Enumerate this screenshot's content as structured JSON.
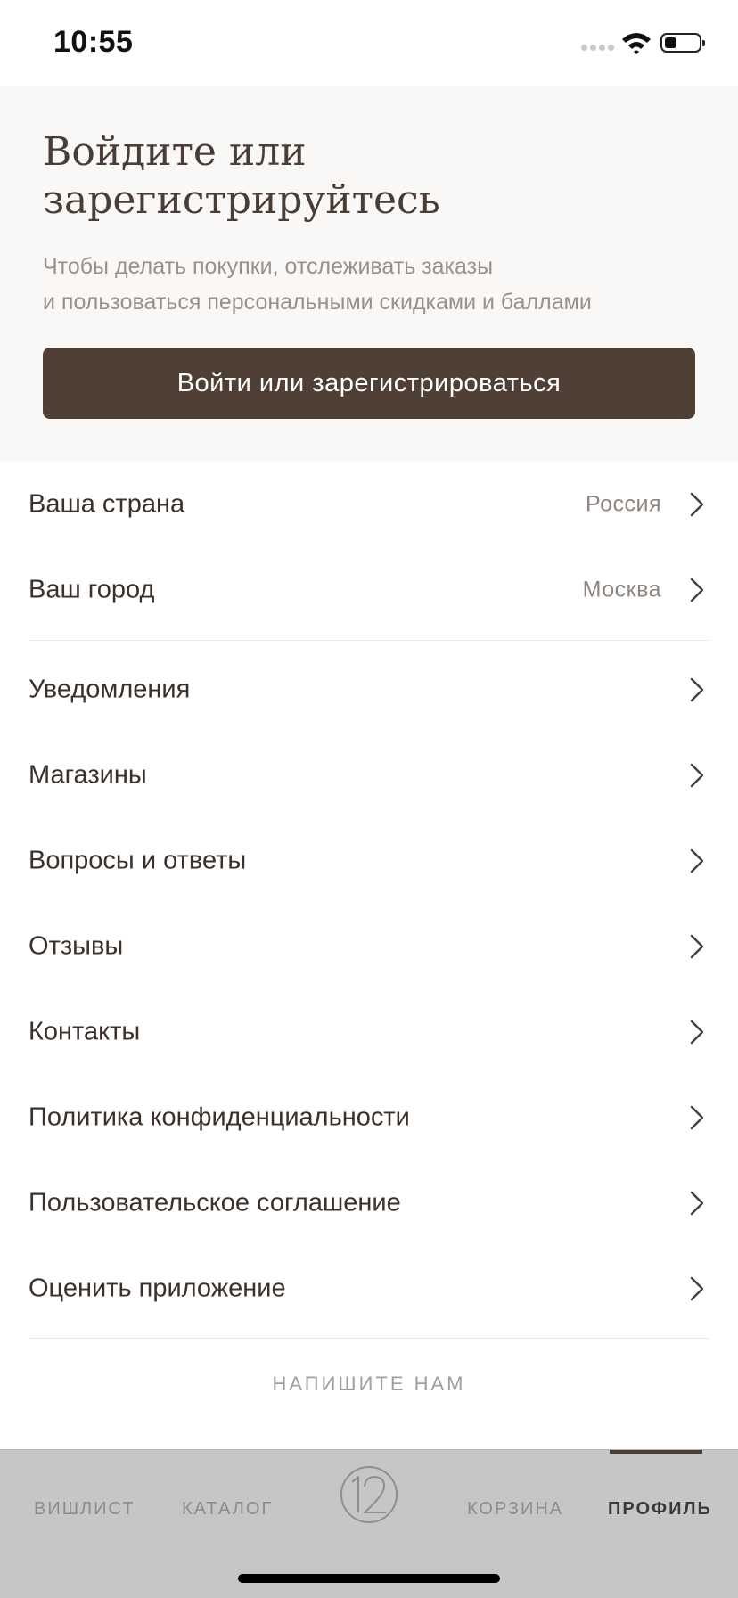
{
  "status_bar": {
    "time": "10:55",
    "battery_level": 0.35
  },
  "hero": {
    "title": "Войдите или зарегистрируйтесь",
    "subtitle_line1": "Чтобы делать покупки, отслеживать заказы",
    "subtitle_line2": "и пользоваться персональными скидками и баллами",
    "button_label": "Войти или зарегистрироваться"
  },
  "location": [
    {
      "label": "Ваша страна",
      "value": "Россия"
    },
    {
      "label": "Ваш город",
      "value": "Москва"
    }
  ],
  "menu": [
    {
      "label": "Уведомления"
    },
    {
      "label": "Магазины"
    },
    {
      "label": "Вопросы и ответы"
    },
    {
      "label": "Отзывы"
    },
    {
      "label": "Контакты"
    },
    {
      "label": "Политика конфиденциальности"
    },
    {
      "label": "Пользовательское соглашение"
    },
    {
      "label": "Оценить приложение"
    }
  ],
  "write_us": "НАПИШИТЕ НАМ",
  "tabbar": {
    "wishlist": "ВИШЛИСТ",
    "catalog": "КАТАЛОГ",
    "cart": "КОРЗИНА",
    "profile": "ПРОФИЛЬ",
    "active": "profile"
  },
  "icons": {
    "chevron": "chevron-right-icon",
    "logo": "brand-logo-icon",
    "wifi": "wifi-icon",
    "battery": "battery-icon"
  },
  "colors": {
    "accent": "#503f35",
    "hero_bg": "#faf8f6",
    "tabbar_bg": "#c6c6c6"
  }
}
